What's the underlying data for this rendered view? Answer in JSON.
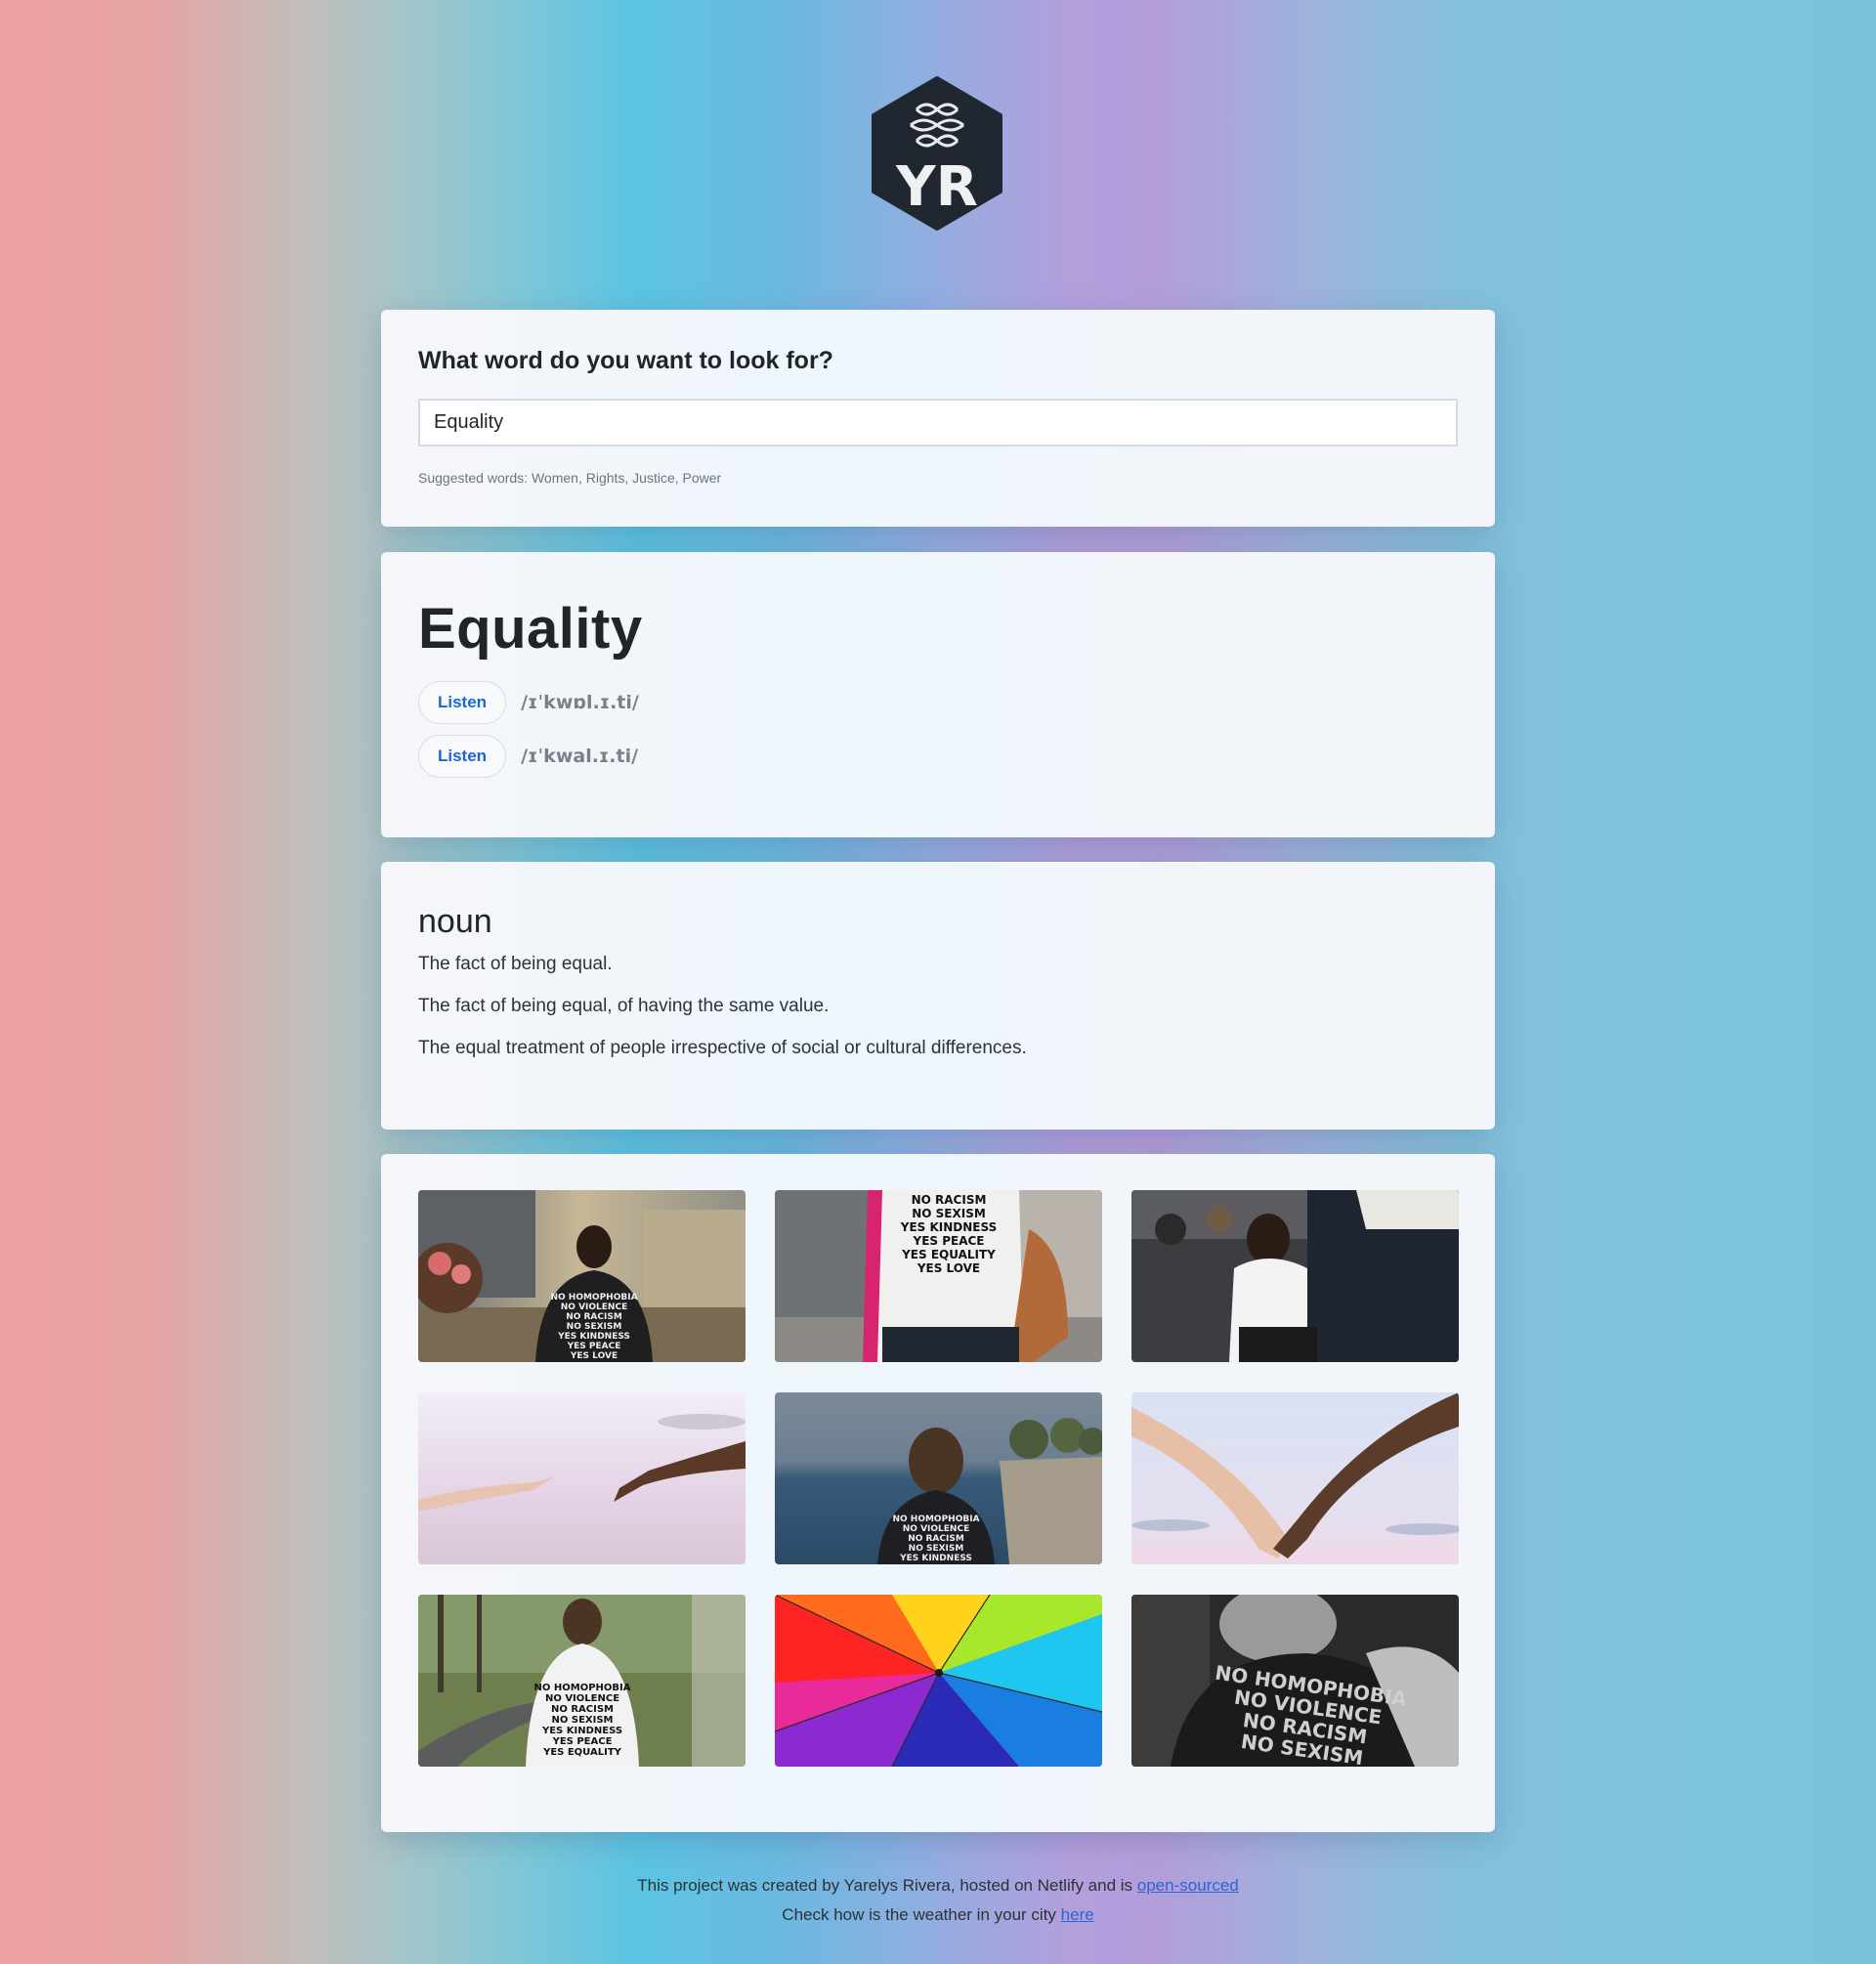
{
  "logo": {
    "text": "YR"
  },
  "search": {
    "title": "What word do you want to look for?",
    "value": "Equality",
    "suggested": "Suggested words: Women, Rights, Justice, Power"
  },
  "word": {
    "title": "Equality",
    "phonetics": [
      {
        "listen_label": "Listen",
        "text": "/ɪˈkwɒl.ɪ.ti/"
      },
      {
        "listen_label": "Listen",
        "text": "/ɪˈkwal.ɪ.ti/"
      }
    ]
  },
  "meaning": {
    "part_of_speech": "noun",
    "definitions": [
      "The fact of being equal.",
      "The fact of being equal, of having the same value.",
      "The equal treatment of people irrespective of social or cultural differences."
    ]
  },
  "photos": [
    {
      "name": "photo-woman-shirt-city",
      "shirt": [
        "NO HOMOPHOBIA",
        "NO VIOLENCE",
        "NO RACISM",
        "NO SEXISM",
        "YES KINDNESS",
        "YES PEACE",
        "YES LOVE"
      ]
    },
    {
      "name": "photo-shirt-back-street",
      "shirt": [
        "NO RACISM",
        "NO SEXISM",
        "YES KINDNESS",
        "YES PEACE",
        "YES EQUALITY",
        "YES LOVE"
      ]
    },
    {
      "name": "photo-seated-people",
      "shirt": []
    },
    {
      "name": "photo-hands-reaching",
      "shirt": []
    },
    {
      "name": "photo-woman-sea",
      "shirt": [
        "NO HOMOPHOBIA",
        "NO VIOLENCE",
        "NO RACISM",
        "NO SEXISM",
        "YES KINDNESS"
      ]
    },
    {
      "name": "photo-holding-hands",
      "shirt": []
    },
    {
      "name": "photo-man-park",
      "shirt": [
        "NO HOMOPHOBIA",
        "NO VIOLENCE",
        "NO RACISM",
        "NO SEXISM",
        "YES KINDNESS",
        "YES PEACE",
        "YES EQUALITY"
      ]
    },
    {
      "name": "photo-rainbow-umbrella",
      "shirt": []
    },
    {
      "name": "photo-bw-shirt",
      "shirt": [
        "NO HOMOPHOBIA",
        "NO VIOLENCE",
        "NO RACISM",
        "NO SEXISM"
      ]
    }
  ],
  "footer": {
    "line1_prefix": "This project was created by Yarelys Rivera, hosted on Netlify and is ",
    "line1_link": "open-sourced",
    "line2_prefix": "Check how is the weather in your city ",
    "line2_link": "here"
  },
  "colors": {
    "accent": "#1a66d6",
    "link": "#2b63d8",
    "logo_bg": "#212730"
  }
}
